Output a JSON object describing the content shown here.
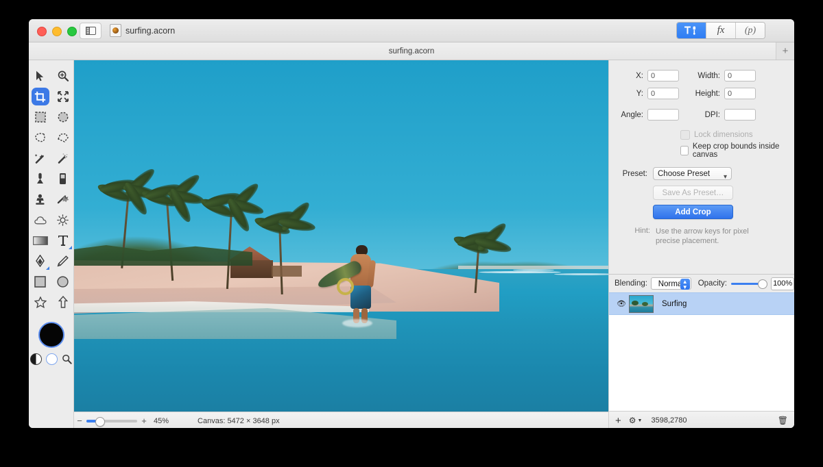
{
  "window": {
    "title": "surfing.acorn",
    "traffic_lights": [
      "close",
      "minimize",
      "zoom"
    ],
    "sidebar_toggle_icon": "sidebar-icon",
    "doc_icon": "acorn-document-icon",
    "segmented": [
      {
        "id": "tools",
        "icon": "tool-adjust-icon",
        "active": true
      },
      {
        "id": "filters",
        "label": "fx",
        "active": false
      },
      {
        "id": "palette",
        "label": "(p)",
        "active": false
      }
    ]
  },
  "tabbar": {
    "title": "surfing.acorn",
    "add_label": "+"
  },
  "tools": {
    "items": [
      {
        "name": "move-tool",
        "icon": "cursor-arrow-icon",
        "selected": false
      },
      {
        "name": "zoom-tool",
        "icon": "magnifier-plus-icon",
        "selected": false
      },
      {
        "name": "crop-tool",
        "icon": "crop-icon",
        "selected": true
      },
      {
        "name": "transform-tool",
        "icon": "arrows-expand-icon",
        "selected": false
      },
      {
        "name": "rectangle-select-tool",
        "icon": "marquee-rect-icon",
        "selected": false
      },
      {
        "name": "ellipse-select-tool",
        "icon": "marquee-ellipse-icon",
        "selected": false
      },
      {
        "name": "lasso-tool",
        "icon": "lasso-icon",
        "selected": false
      },
      {
        "name": "polygon-lasso-tool",
        "icon": "polygon-lasso-icon",
        "selected": false
      },
      {
        "name": "magic-wand-tool",
        "icon": "magic-wand-icon",
        "selected": false
      },
      {
        "name": "instant-alpha-tool",
        "icon": "sparkle-wand-icon",
        "selected": false
      },
      {
        "name": "paint-bucket-tool",
        "icon": "paint-bucket-icon",
        "selected": false
      },
      {
        "name": "eraser-tool",
        "icon": "eraser-icon",
        "selected": false
      },
      {
        "name": "clone-stamp-tool",
        "icon": "clone-stamp-icon",
        "selected": false
      },
      {
        "name": "smudge-tool",
        "icon": "smudge-icon",
        "selected": false
      },
      {
        "name": "blur-tool",
        "icon": "cloud-blur-icon",
        "selected": false
      },
      {
        "name": "dodge-burn-tool",
        "icon": "sun-dodge-icon",
        "selected": false
      },
      {
        "name": "gradient-tool",
        "icon": "gradient-icon",
        "selected": false
      },
      {
        "name": "text-tool",
        "icon": "text-T-icon",
        "selected": false
      },
      {
        "name": "bezier-pen-tool",
        "icon": "pen-nib-icon",
        "selected": false
      },
      {
        "name": "pencil-tool",
        "icon": "pencil-icon",
        "selected": false
      },
      {
        "name": "rectangle-shape-tool",
        "icon": "square-shape-icon",
        "selected": false
      },
      {
        "name": "ellipse-shape-tool",
        "icon": "circle-shape-icon",
        "selected": false
      },
      {
        "name": "star-shape-tool",
        "icon": "star-shape-icon",
        "selected": false
      },
      {
        "name": "arrow-shape-tool",
        "icon": "arrow-shape-icon",
        "selected": false
      }
    ],
    "color_well": {
      "name": "foreground-color-well",
      "color": "#050505"
    },
    "mini": [
      {
        "name": "swap-colors-icon"
      },
      {
        "name": "default-colors-icon"
      },
      {
        "name": "loupe-icon"
      }
    ]
  },
  "crop_panel": {
    "fields": [
      {
        "label": "X:",
        "value": "0",
        "name": "crop-x-input"
      },
      {
        "label": "Width:",
        "value": "0",
        "name": "crop-width-input"
      },
      {
        "label": "Y:",
        "value": "0",
        "name": "crop-y-input"
      },
      {
        "label": "Height:",
        "value": "0",
        "name": "crop-height-input"
      },
      {
        "label": "Angle:",
        "value": "",
        "name": "crop-angle-input"
      },
      {
        "label": "DPI:",
        "value": "",
        "name": "crop-dpi-input"
      }
    ],
    "labels": {
      "x": "X:",
      "y": "Y:",
      "width": "Width:",
      "height": "Height:",
      "angle": "Angle:",
      "dpi": "DPI:",
      "preset": "Preset:",
      "hint": "Hint:"
    },
    "values": {
      "x": "0",
      "y": "0",
      "width": "0",
      "height": "0",
      "angle": "",
      "dpi": ""
    },
    "lock_dimensions": {
      "label": "Lock dimensions",
      "checked": false,
      "enabled": false
    },
    "keep_bounds": {
      "label": "Keep crop bounds inside canvas",
      "checked": false,
      "enabled": true
    },
    "preset_select": {
      "value": "Choose Preset",
      "options": [
        "Choose Preset"
      ]
    },
    "save_preset_button": {
      "label": "Save As Preset…",
      "enabled": false
    },
    "add_crop_button": {
      "label": "Add Crop",
      "accent": "#3b7ff0"
    },
    "hint_text": "Use the arrow keys for pixel precise placement."
  },
  "layers": {
    "blending_label": "Blending:",
    "blending_value": "Normal",
    "opacity_label": "Opacity:",
    "opacity_value": "100%",
    "opacity_percent": 100,
    "rows": [
      {
        "name": "Surfing",
        "visible": true,
        "selected": true
      }
    ],
    "footer": {
      "add_label": "+",
      "gear_icon": "gear-icon",
      "coords": "3598,2780",
      "trash_icon": "trash-icon"
    }
  },
  "status": {
    "zoom_minus": "−",
    "zoom_plus": "+",
    "zoom_percent": "45%",
    "zoom_value": 45,
    "canvas_label": "Canvas: 5472 × 3648 px"
  }
}
